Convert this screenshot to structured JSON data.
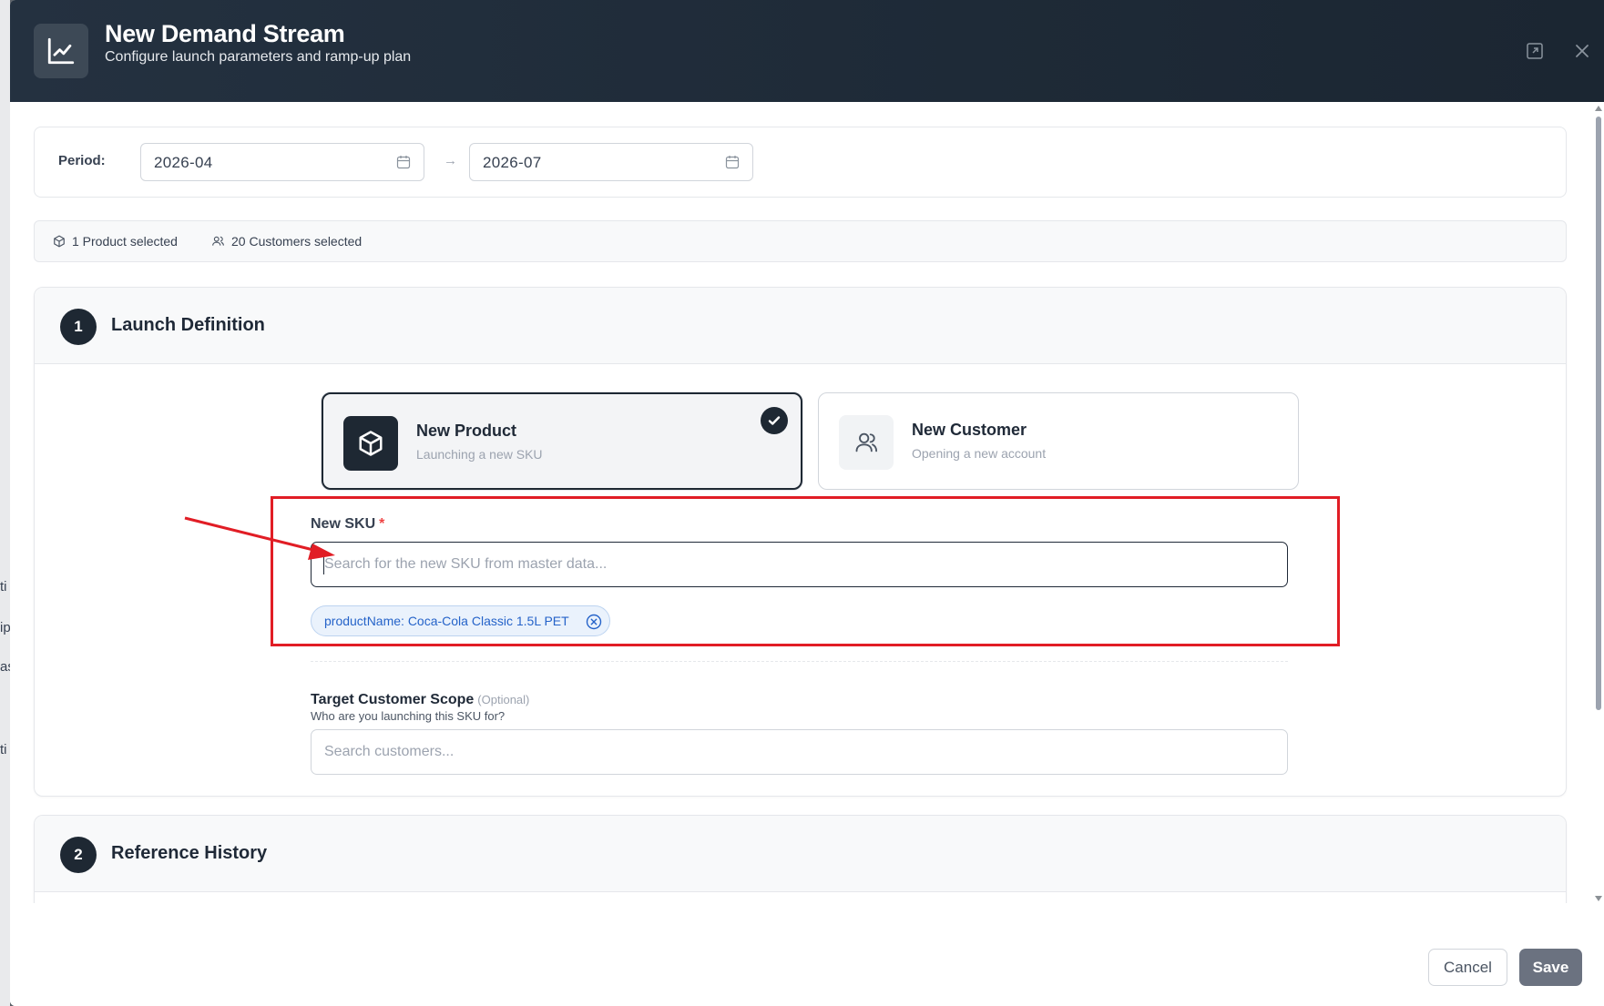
{
  "backdrop": {
    "fragments": [
      "ti",
      "ip",
      "as",
      "ti"
    ]
  },
  "header": {
    "title": "New Demand Stream",
    "subtitle": "Configure launch parameters and ramp-up plan",
    "icon": "line-chart-icon"
  },
  "period": {
    "label": "Period:",
    "start": "2026-04",
    "end": "2026-07",
    "separator": "→"
  },
  "summary": {
    "products": "1 Product selected",
    "customers": "20 Customers selected"
  },
  "section1": {
    "number": "1",
    "title": "Launch Definition",
    "choices": [
      {
        "title": "New Product",
        "subtitle": "Launching a new SKU",
        "selected": true,
        "icon": "cube-icon"
      },
      {
        "title": "New Customer",
        "subtitle": "Opening a new account",
        "selected": false,
        "icon": "users-icon"
      }
    ],
    "sku": {
      "label": "New SKU",
      "required_mark": "*",
      "placeholder": "Search for the new SKU from master data...",
      "value": "",
      "chip": "productName: Coca-Cola Classic 1.5L PET"
    },
    "scope": {
      "label": "Target Customer Scope",
      "optional": "(Optional)",
      "hint": "Who are you launching this SKU for?",
      "placeholder": "Search customers..."
    }
  },
  "section2": {
    "number": "2",
    "title": "Reference History"
  },
  "footer": {
    "cancel": "Cancel",
    "save": "Save"
  },
  "colors": {
    "header_bg": "#1e2a37",
    "accent_dark": "#1e2833",
    "chip_text": "#2563c9",
    "annotation_red": "#e11d25",
    "save_bg": "#6b7280"
  }
}
